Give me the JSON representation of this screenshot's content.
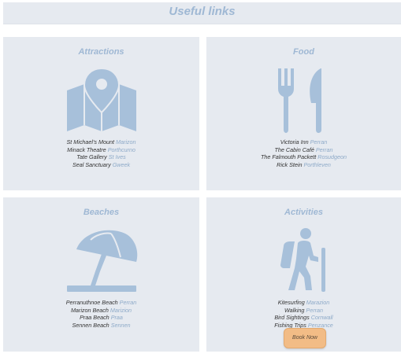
{
  "page_title": "Useful links",
  "colors": {
    "accent": "#9fb8d4",
    "card_bg": "#e6eaf0",
    "icon": "#a7c0da",
    "button": "#f2bc86"
  },
  "cards": {
    "attractions": {
      "title": "Attractions",
      "icon": "map-pin-icon",
      "items": [
        {
          "name": "St Michael's Mount",
          "location": "Marizon"
        },
        {
          "name": "Minack Theatre",
          "location": "Porthcurno"
        },
        {
          "name": "Tate Gallery",
          "location": "St Ives"
        },
        {
          "name": "Seal Sanctuary",
          "location": "Gweek"
        }
      ]
    },
    "food": {
      "title": "Food",
      "icon": "fork-knife-icon",
      "items": [
        {
          "name": "Victoria Inn",
          "location": "Perran"
        },
        {
          "name": "The Cabin Café",
          "location": "Perran"
        },
        {
          "name": "The Falmouth Packett",
          "location": "Rosudgeon"
        },
        {
          "name": "Rick Stein",
          "location": "Porthleven"
        }
      ]
    },
    "beaches": {
      "title": "Beaches",
      "icon": "beach-umbrella-icon",
      "items": [
        {
          "name": "Perranuthnoe Beach",
          "location": "Perran"
        },
        {
          "name": "Marizon Beach",
          "location": "Marizion"
        },
        {
          "name": "Praa Beach",
          "location": "Praa"
        },
        {
          "name": "Sennen Beach",
          "location": "Sennen"
        }
      ]
    },
    "activities": {
      "title": "Activities",
      "icon": "hiker-icon",
      "items": [
        {
          "name": "Kitesurfing",
          "location": "Marazion"
        },
        {
          "name": "Walking",
          "location": "Perran"
        },
        {
          "name": "Bird Sightings",
          "location": "Cornwall"
        },
        {
          "name": "Fishing Trips",
          "location": "Penzance"
        }
      ],
      "button_label": "Book Now"
    }
  }
}
